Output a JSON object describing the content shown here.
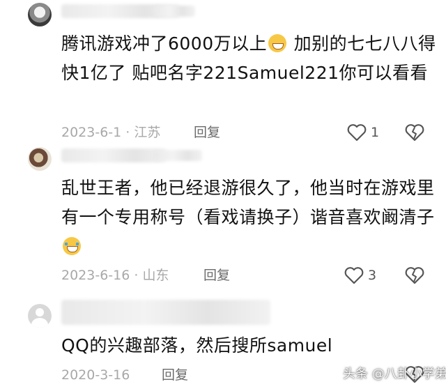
{
  "comments": [
    {
      "text_part1": "腾讯游戏冲了6000万以上",
      "emoji_1": "grinning-sweat-emoji",
      "text_part2": " 加别的七七八八得快1亿了 贴吧名字221Samuel221你可以看看",
      "date": "2023-6-1",
      "location": "江苏",
      "reply_label": "回复",
      "likes": "1"
    },
    {
      "text_part1": "乱世王者，他已经退游很久了，他当时在游戏里有一个专用称号（看戏请换子）谐音喜欢阚清子",
      "emoji_1": "crying-laughing-emoji",
      "date": "2023-6-16",
      "location": "山东",
      "reply_label": "回复",
      "likes": "3"
    },
    {
      "text_part1": "QQ的兴趣部落，然后搜所samuel",
      "date": "2020-3-16",
      "reply_label": "回复"
    }
  ],
  "watermark": "头条 @八卦小学弟",
  "colors": {
    "text": "#111111",
    "meta": "#a8a8a8",
    "reply": "#6a6a6a",
    "icon": "#555555"
  }
}
